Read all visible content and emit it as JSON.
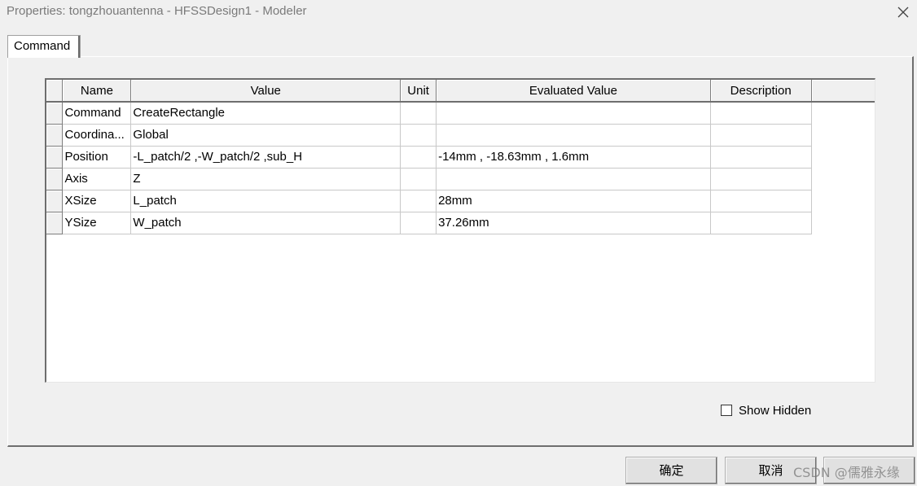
{
  "window": {
    "title": "Properties: tongzhouantenna - HFSSDesign1 - Modeler"
  },
  "tabs": [
    {
      "label": "Command"
    }
  ],
  "table": {
    "columns": [
      "Name",
      "Value",
      "Unit",
      "Evaluated Value",
      "Description"
    ],
    "rows": [
      {
        "name": "Command",
        "value": "CreateRectangle",
        "unit": "",
        "evaluated": "",
        "description": ""
      },
      {
        "name": "Coordina...",
        "value": "Global",
        "unit": "",
        "evaluated": "",
        "description": ""
      },
      {
        "name": "Position",
        "value": "-L_patch/2 ,-W_patch/2 ,sub_H",
        "unit": "",
        "evaluated": "-14mm , -18.63mm , 1.6mm",
        "description": ""
      },
      {
        "name": "Axis",
        "value": "Z",
        "unit": "",
        "evaluated": "",
        "description": ""
      },
      {
        "name": "XSize",
        "value": "L_patch",
        "unit": "",
        "evaluated": "28mm",
        "description": ""
      },
      {
        "name": "YSize",
        "value": "W_patch",
        "unit": "",
        "evaluated": "37.26mm",
        "description": ""
      }
    ]
  },
  "show_hidden": {
    "label": "Show Hidden",
    "checked": false
  },
  "buttons": {
    "ok_label": "确定",
    "cancel_label": "取消",
    "help_label": ""
  },
  "watermark": "CSDN @儒雅永缘",
  "icons": {
    "close": "close-icon"
  }
}
